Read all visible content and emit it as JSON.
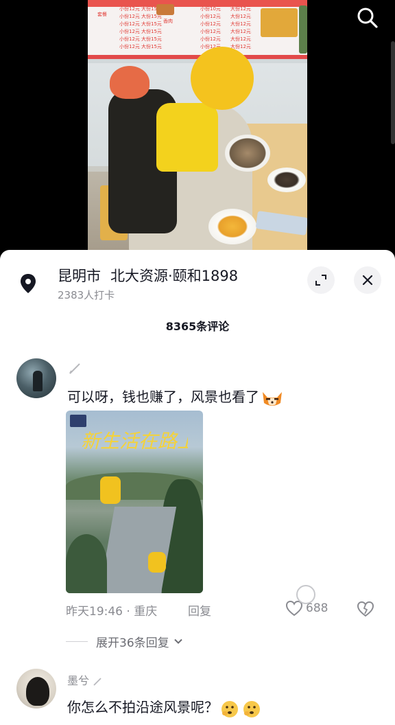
{
  "video": {
    "menu_board": {
      "header": "套餐",
      "col1": [
        "小份12元",
        "小份12元",
        "小份12元",
        "小份12元",
        "小份12元",
        "小份12元"
      ],
      "col2": [
        "大份15元",
        "大份15元",
        "大份15元",
        "大份15元",
        "大份15元",
        "大份15元"
      ],
      "col3": [
        "小份10元",
        "小份12元",
        "小份12元",
        "小份12元",
        "小份12元",
        "小份12元"
      ],
      "col4": [
        "大份12元",
        "大份12元",
        "大份12元",
        "大份12元",
        "大份12元",
        "大份12元"
      ],
      "tag": "香肉"
    },
    "search_icon": "search-icon"
  },
  "location": {
    "city": "昆明市",
    "place": "北大资源·颐和1898",
    "checkins": "2383人打卡"
  },
  "comments_header": "8365条评论",
  "comments": [
    {
      "username": "",
      "text": "可以呀，钱也赚了，风景也看了",
      "emoji": "fox-emoji",
      "image": {
        "headline": "新生活在路上"
      },
      "time_location": "昨天19:46 · 重庆",
      "reply_label": "回复",
      "likes": "688",
      "expand_label": "展开36条回复"
    },
    {
      "username": "墨兮",
      "text": "你怎么不拍沿途风景呢？",
      "emoji": "thinking-emoji"
    }
  ],
  "colors": {
    "text_primary": "#161823",
    "text_secondary": "#8a8b91",
    "menu_red": "#e13b35"
  }
}
